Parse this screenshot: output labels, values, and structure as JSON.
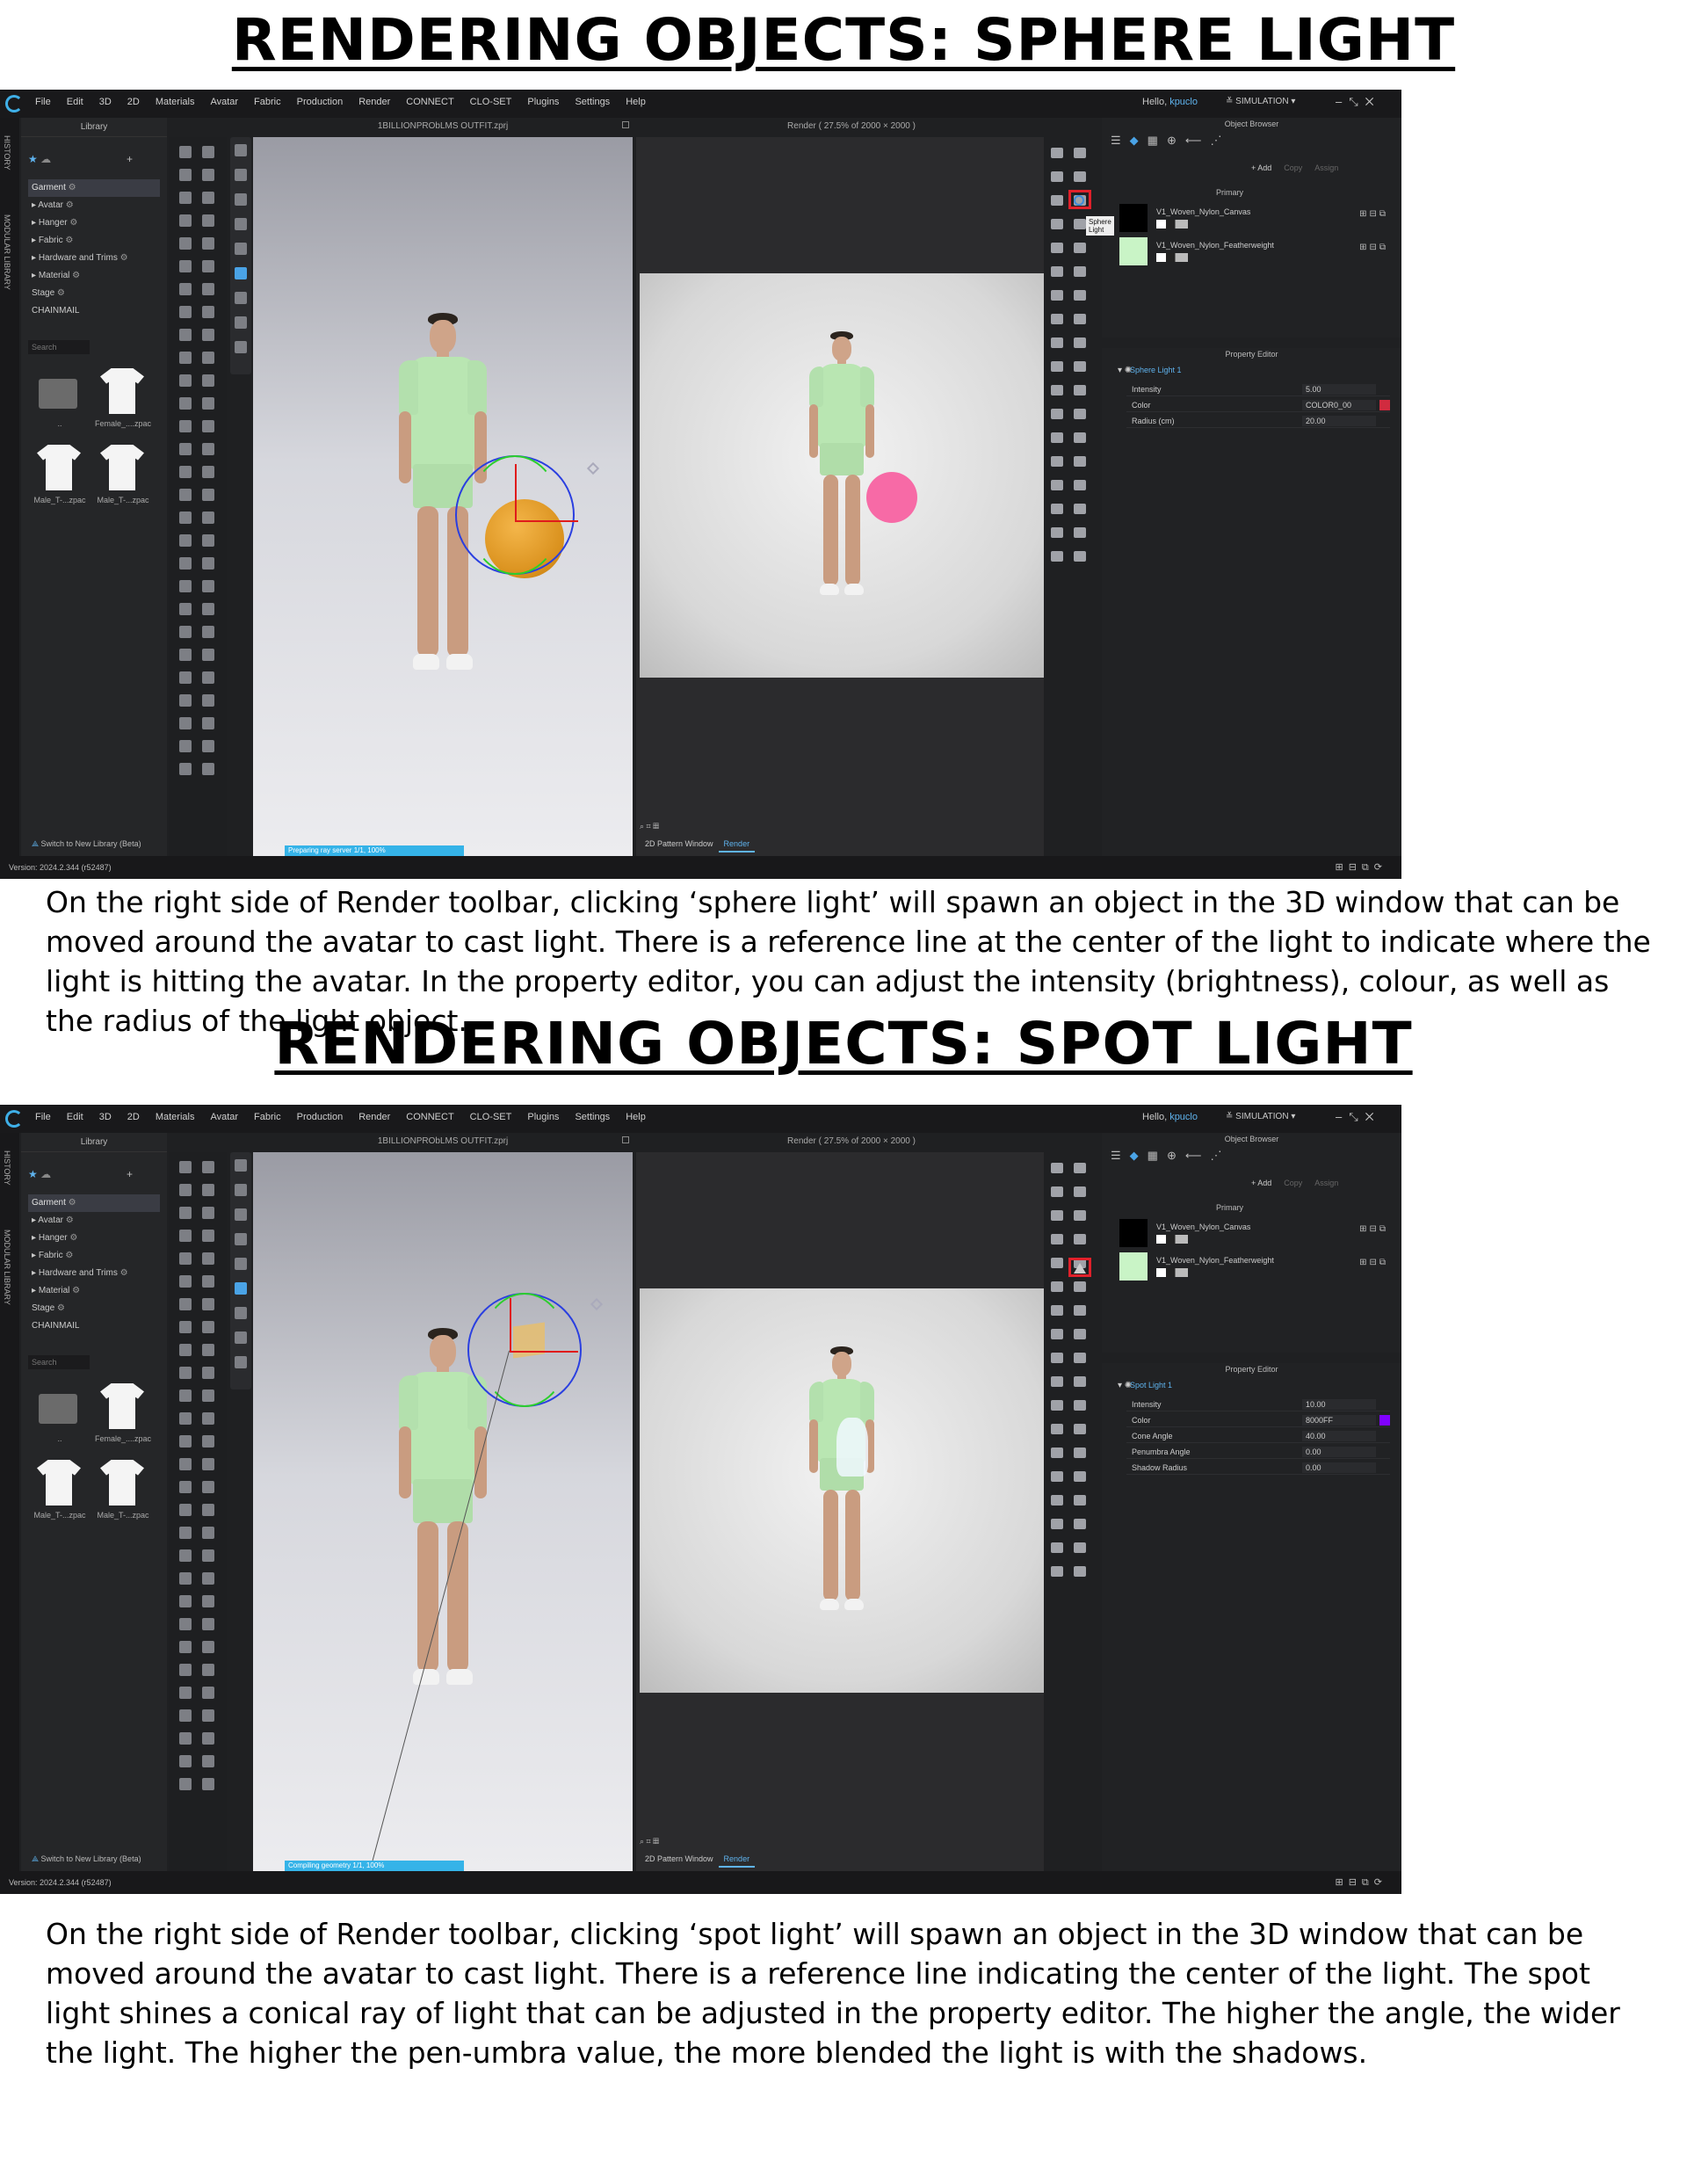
{
  "sections": [
    {
      "title": "RENDERING OBJECTS:  SPHERE LIGHT",
      "caption": "On the right side of Render toolbar, clicking ‘sphere light’ will spawn an object in the 3D window that can be moved around the avatar to cast light. There is a reference line at the center of the light to indicate where the light is hitting the avatar. In the property editor, you can adjust the intensity (brightness), colour, as well as the radius of the light object.",
      "app": {
        "menu": [
          "File",
          "Edit",
          "3D",
          "2D",
          "Materials",
          "Avatar",
          "Fabric",
          "Production",
          "Render",
          "CONNECT",
          "CLO-SET",
          "Plugins",
          "Settings",
          "Help"
        ],
        "hello": "Hello,",
        "user": "kpuclo",
        "mode": "SIMULATION",
        "vtabs": [
          "HISTORY",
          "MODULAR LIBRARY"
        ],
        "library_title": "Library",
        "library_tree": [
          "Garment",
          "Avatar",
          "Hanger",
          "Fabric",
          "Hardware and Trims",
          "Material",
          "Stage",
          "CHAINMAIL"
        ],
        "search_placeholder": "Search",
        "files": [
          "..",
          "Female_....zpac",
          "Male_T-...zpac",
          "Male_T-...zpac"
        ],
        "switch_library": "Switch to New Library (Beta)",
        "viewport_title": "1BILLIONPRObLMS OUTFIT.zprj",
        "render_title": "Render ( 27.5% of 2000 × 2000 )",
        "render_tabs": [
          "2D Pattern Window",
          "Render"
        ],
        "progress": "Preparing ray server 1/1, 100%",
        "tooltip": "Sphere Light",
        "object_browser": "Object Browser",
        "add_label": "+ Add",
        "copy_label": "Copy",
        "assign_label": "Assign",
        "primary": "Primary",
        "fabrics": [
          {
            "name": "V1_Woven_Nylon_Canvas",
            "color": "#000000"
          },
          {
            "name": "V1_Woven_Nylon_Featherweight",
            "color": "#c9f4c6"
          }
        ],
        "property_editor": "Property Editor",
        "light_name": "Sphere Light 1",
        "properties": [
          {
            "key": "Intensity",
            "value": "5.00"
          },
          {
            "key": "Color",
            "value": "COLOR0_00",
            "swatch": "#d12b3f"
          },
          {
            "key": "Radius (cm)",
            "value": "20.00"
          }
        ],
        "version": "Version: 2024.2.344 (r52487)",
        "light_color": "#f76aa6"
      }
    },
    {
      "title": "RENDERING OBJECTS:  SPOT LIGHT",
      "caption": "On the right side of Render toolbar, clicking ‘spot light’ will spawn an object in the 3D window that can be moved around the avatar to cast light. There is a reference line indicating the center of the light. The spot light shines a conical ray of light that can be adjusted in the property editor. The higher the angle, the wider the light. The higher the pen-umbra value, the more blended the light is with the shadows.",
      "app": {
        "menu": [
          "File",
          "Edit",
          "3D",
          "2D",
          "Materials",
          "Avatar",
          "Fabric",
          "Production",
          "Render",
          "CONNECT",
          "CLO-SET",
          "Plugins",
          "Settings",
          "Help"
        ],
        "hello": "Hello,",
        "user": "kpuclo",
        "mode": "SIMULATION",
        "vtabs": [
          "HISTORY",
          "MODULAR LIBRARY"
        ],
        "library_title": "Library",
        "library_tree": [
          "Garment",
          "Avatar",
          "Hanger",
          "Fabric",
          "Hardware and Trims",
          "Material",
          "Stage",
          "CHAINMAIL"
        ],
        "search_placeholder": "Search",
        "files": [
          "..",
          "Female_....zpac",
          "Male_T-...zpac",
          "Male_T-...zpac"
        ],
        "switch_library": "Switch to New Library (Beta)",
        "viewport_title": "1BILLIONPRObLMS OUTFIT.zprj",
        "render_title": "Render ( 27.5% of 2000 × 2000 )",
        "render_tabs": [
          "2D Pattern Window",
          "Render"
        ],
        "progress": "Compiling geometry 1/1, 100%",
        "object_browser": "Object Browser",
        "add_label": "+ Add",
        "copy_label": "Copy",
        "assign_label": "Assign",
        "primary": "Primary",
        "fabrics": [
          {
            "name": "V1_Woven_Nylon_Canvas",
            "color": "#000000"
          },
          {
            "name": "V1_Woven_Nylon_Featherweight",
            "color": "#c9f4c6"
          }
        ],
        "property_editor": "Property Editor",
        "light_name": "Spot Light 1",
        "properties": [
          {
            "key": "Intensity",
            "value": "10.00"
          },
          {
            "key": "Color",
            "value": "8000FF",
            "swatch": "#8000ff"
          },
          {
            "key": "Cone Angle",
            "value": "40.00"
          },
          {
            "key": "Penumbra Angle",
            "value": "0.00"
          },
          {
            "key": "Shadow Radius",
            "value": "0.00"
          }
        ],
        "version": "Version: 2024.2.344 (r52487)",
        "light_color": "#e8f2ff"
      }
    }
  ]
}
